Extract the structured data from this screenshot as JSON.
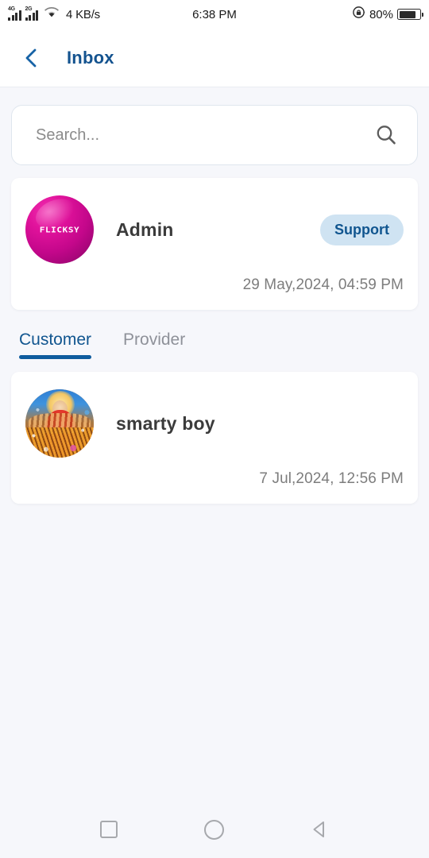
{
  "status_bar": {
    "network_4g": "4G",
    "network_2g": "2G",
    "wifi_icon": "wifi-icon",
    "data_speed": "4 KB/s",
    "clock": "6:38 PM",
    "rotation_lock_icon": "rotation-lock-icon",
    "battery_percent": "80%",
    "battery_level": 80
  },
  "header": {
    "back_icon": "chevron-left-icon",
    "title": "Inbox",
    "title_color": "#14538f"
  },
  "search": {
    "placeholder": "Search...",
    "value": "",
    "icon": "search-icon"
  },
  "support_card": {
    "avatar_label": "FLICKSY",
    "avatar_type": "flicksy-logo",
    "name": "Admin",
    "badge": "Support",
    "badge_bg": "#cfe3f2",
    "badge_text_color": "#10558f",
    "timestamp": "29 May,2024, 04:59 PM"
  },
  "tabs": [
    {
      "label": "Customer",
      "active": true
    },
    {
      "label": "Provider",
      "active": false
    }
  ],
  "conversations": [
    {
      "avatar_type": "photo",
      "name": "smarty boy",
      "timestamp": "7 Jul,2024, 12:56 PM"
    }
  ],
  "nav_bar": {
    "recents_icon": "square-recents-icon",
    "home_icon": "circle-home-icon",
    "back_icon": "triangle-back-icon"
  },
  "theme": {
    "background": "#f6f7fb",
    "card_background": "#ffffff",
    "accent": "#10558f",
    "muted_text": "#7d7d7d"
  }
}
